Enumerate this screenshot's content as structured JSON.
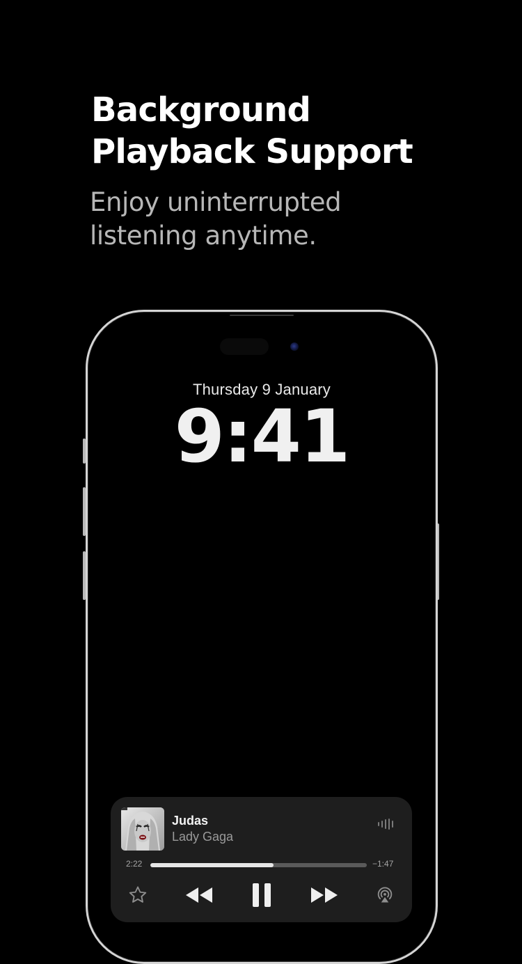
{
  "promo": {
    "headline_line1": "Background",
    "headline_line2": "Playback Support",
    "subhead_line1": "Enjoy uninterrupted",
    "subhead_line2": "listening anytime."
  },
  "lockscreen": {
    "date": "Thursday 9 January",
    "time": "9:41"
  },
  "now_playing": {
    "title": "Judas",
    "artist": "Lady Gaga",
    "elapsed": "2:22",
    "remaining": "−1:47",
    "progress": 0.57,
    "controls": [
      "star-icon",
      "rewind-icon",
      "pause-icon",
      "fast-forward-icon",
      "airplay-icon"
    ]
  },
  "colors": {
    "background": "#000000",
    "headline": "#ffffff",
    "subhead": "#b7b7b7",
    "player_background": "#1e1e1e",
    "progress_fill": "#e6e6e6",
    "progress_track": "#5a5a5a"
  }
}
